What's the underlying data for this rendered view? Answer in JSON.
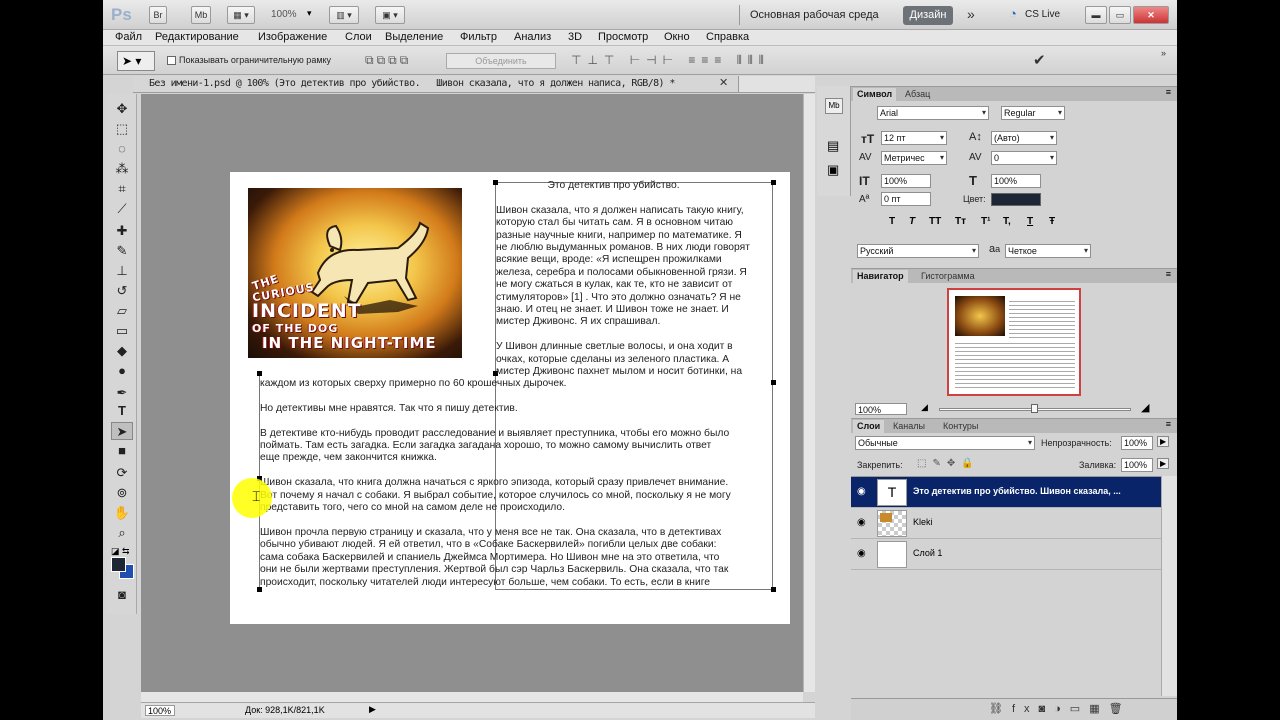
{
  "titlebar": {
    "logo": "Ps",
    "br": "Br",
    "mb": "Mb",
    "zoom": "100%",
    "workspace": "Основная рабочая среда",
    "design": "Дизайн",
    "cslive": "CS Live"
  },
  "menu": [
    "Файл",
    "Редактирование",
    "Изображение",
    "Слои",
    "Выделение",
    "Фильтр",
    "Анализ",
    "3D",
    "Просмотр",
    "Окно",
    "Справка"
  ],
  "options": {
    "checkbox_label": "Показывать ограничительную рамку",
    "combine_label": "Объединить"
  },
  "document": {
    "tab_title": "Без имени-1.psd @ 100% (Это детектив про убийство.   Шивон сказала, что я должен написа, RGB/8) *",
    "book": {
      "line1": "THE",
      "line2": "CURIOUS",
      "line3": "INCIDENT",
      "line4": "OF THE DOG",
      "line5": "IN THE NIGHT-TIME"
    },
    "text_top": "                  Это детектив про убийство.\n\nШивон сказала, что я должен написать такую книгу,\nкоторую стал бы читать сам. Я в основном читаю\nразные научные книги, например по математике. Я\nне люблю выдуманных романов. В них люди говорят\nвсякие вещи, вроде: «Я испещрен прожилками\nжелеза, серебра и полосами обыкновенной грязи. Я\nне могу сжаться в кулак, как те, кто не зависит от\nстимуляторов» [1] . Что это должно означать? Я не\nзнаю. И отец не знает. И Шивон тоже не знает. И\nмистер Дживонс. Я их спрашивал.\n\nУ Шивон длинные светлые волосы, и она ходит в\nочках, которые сделаны из зеленого пластика. А\nмистер Дживонс пахнет мылом и носит ботинки, на",
    "text_bottom": "каждом из которых сверху примерно по 60 крошечных дырочек.\n\nНо детективы мне нравятся. Так что я пишу детектив.\n\nВ детективе кто-нибудь проводит расследование и выявляет преступника, чтобы его можно было\nпоймать. Там есть загадка. Если загадка загадана хорошо, то можно самому вычислить ответ\nеще прежде, чем закончится книжка.\n\nШивон сказала, что книга должна начаться с яркого эпизода, который сразу привлечет внимание.\nВот почему я начал с собаки. Я выбрал событие, которое случилось со мной, поскольку я не могу\nпредставить того, чего со мной на самом деле не происходило.\n\nШивон прочла первую страницу и сказала, что у меня все не так. Она сказала, что в детективах\nобычно убивают людей. Я ей ответил, что в «Собаке Баскервилей» погибли целых две собаки:\nсама собака Баскервилей и спаниель Джеймса Мортимера. Но Шивон мне на это ответила, что\nони не были жертвами преступления. Жертвой был сэр Чарльз Баскервиль. Она сказала, что так\nпроисходит, поскольку читателей люди интересуют больше, чем собаки. То есть, если в книге"
  },
  "statusbar": {
    "zoom": "100%",
    "doc": "Док: 928,1K/821,1K"
  },
  "character_panel": {
    "tab_active": "Символ",
    "tab_other": "Абзац",
    "font_family": "Arial",
    "font_style": "Regular",
    "font_size": "12 пт",
    "leading": "(Авто)",
    "kerning": "Метричес",
    "tracking": "0",
    "vscale": "100%",
    "hscale": "100%",
    "baseline": "0 пт",
    "color_label": "Цвет:",
    "language": "Русский",
    "aa_label": "a",
    "antialias": "Четкое",
    "style_buttons": [
      "T",
      "T",
      "TT",
      "Tт",
      "T¹",
      "T,",
      "T",
      "Ŧ"
    ]
  },
  "navigator_panel": {
    "tab_active": "Навигатор",
    "tab_other": "Гистограмма",
    "zoom": "100%"
  },
  "layers_panel": {
    "tabs": [
      "Слои",
      "Каналы",
      "Контуры"
    ],
    "blend_mode": "Обычные",
    "opacity_label": "Непрозрачность:",
    "opacity": "100%",
    "lock_label": "Закрепить:",
    "fill_label": "Заливка:",
    "fill": "100%",
    "layers": [
      {
        "name": "Это детектив про убийство.   Шивон сказала, ...",
        "type": "text",
        "selected": true
      },
      {
        "name": "Kleki",
        "type": "image",
        "selected": false
      },
      {
        "name": "Слой 1",
        "type": "fill",
        "selected": false
      }
    ]
  },
  "colors": {
    "accent": "#0a246a",
    "foreground": "#1c2634",
    "background": "#1f4db0"
  }
}
